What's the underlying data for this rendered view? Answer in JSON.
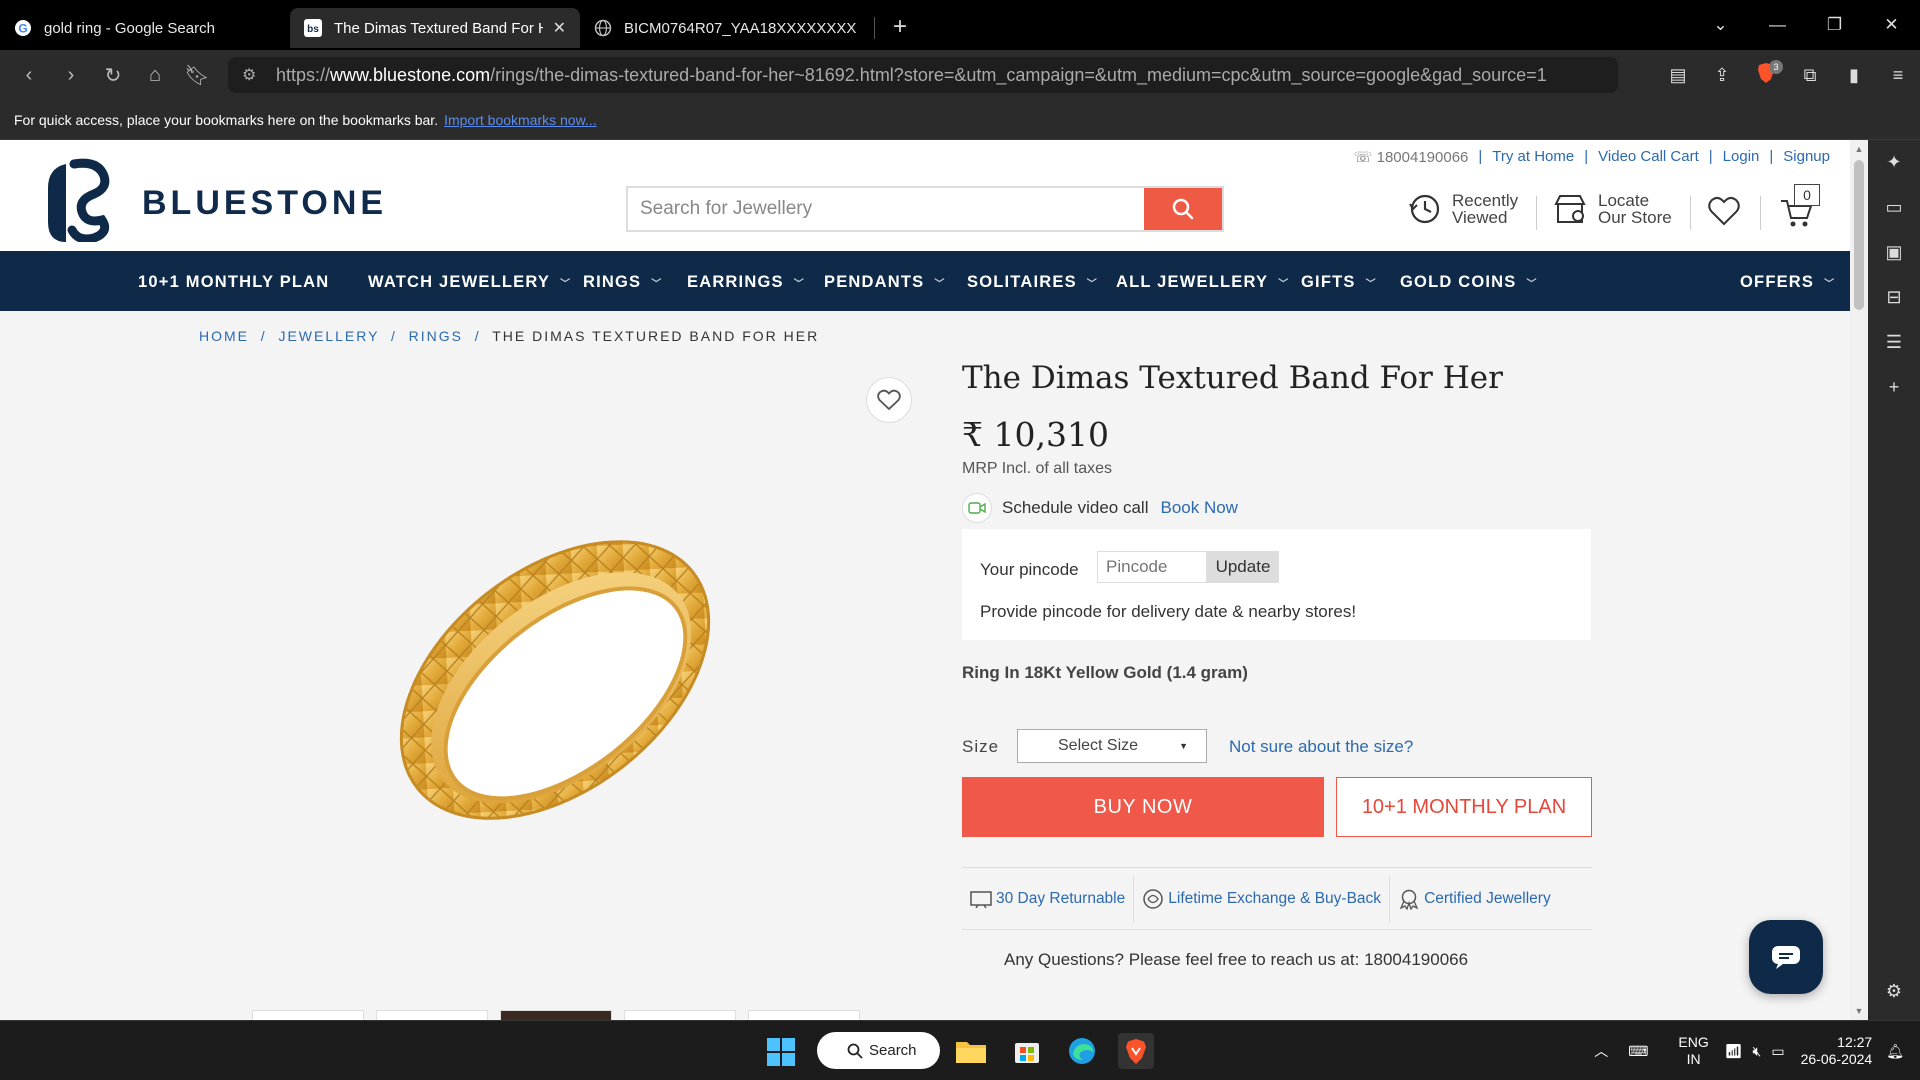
{
  "browser": {
    "tabs": [
      {
        "title": "gold ring - Google Search",
        "active": false
      },
      {
        "title": "The Dimas Textured Band For Her",
        "active": true
      },
      {
        "title": "BICM0764R07_YAA18XXXXXXXXXXXX",
        "active": false
      }
    ],
    "url_scheme": "https://",
    "url_domain": "www.bluestone.com",
    "url_path": "/rings/the-dimas-textured-band-for-her~81692.html?store=&utm_campaign=&utm_medium=cpc&utm_source=google&gad_source=1",
    "brave_badge": "3",
    "bookmarks_message": "For quick access, place your bookmarks here on the bookmarks bar.",
    "bookmarks_link": "Import bookmarks now..."
  },
  "header": {
    "brand": "BLUESTONE",
    "phone": "18004190066",
    "top_links": [
      "Try at Home",
      "Video Call Cart",
      "Login",
      "Signup"
    ],
    "search_placeholder": "Search for Jewellery",
    "recently_viewed": [
      "Recently",
      "Viewed"
    ],
    "locate_store": [
      "Locate",
      "Our Store"
    ],
    "cart_count": "0"
  },
  "nav": {
    "items": [
      "10+1 MONTHLY PLAN",
      "WATCH JEWELLERY",
      "RINGS",
      "EARRINGS",
      "PENDANTS",
      "SOLITAIRES",
      "ALL JEWELLERY",
      "GIFTS",
      "GOLD COINS",
      "OFFERS"
    ]
  },
  "breadcrumb": {
    "items": [
      "HOME",
      "JEWELLERY",
      "RINGS"
    ],
    "current": "THE DIMAS TEXTURED BAND FOR HER",
    "separator": "/"
  },
  "product": {
    "title": "The Dimas Textured Band For Her",
    "price": "₹ 10,310",
    "mrp_note": "MRP Incl. of all taxes",
    "video_call_text": "Schedule video call",
    "video_call_link": "Book Now",
    "pincode_label": "Your pincode",
    "pincode_placeholder": "Pincode",
    "pincode_button": "Update",
    "pincode_note": "Provide pincode for delivery date & nearby stores!",
    "spec": "Ring In 18Kt Yellow Gold (1.4 gram)",
    "size_label": "Size",
    "size_select": "Select Size",
    "size_help": "Not sure about the size?",
    "buy_now": "BUY NOW",
    "monthly_plan": "10+1 MONTHLY PLAN",
    "features": [
      "30 Day Returnable",
      "Lifetime Exchange & Buy-Back",
      "Certified Jewellery"
    ],
    "questions_text": "Any Questions? Please feel free to reach us at:",
    "questions_phone": "18004190066"
  },
  "taskbar": {
    "search_label": "Search",
    "lang_top": "ENG",
    "lang_bottom": "IN",
    "time": "12:27",
    "date": "26-06-2024"
  },
  "colors": {
    "navy": "#0e2a48",
    "accent_red": "#f0594a",
    "link_blue": "#2c6ab0",
    "gold": "#e8b445"
  }
}
